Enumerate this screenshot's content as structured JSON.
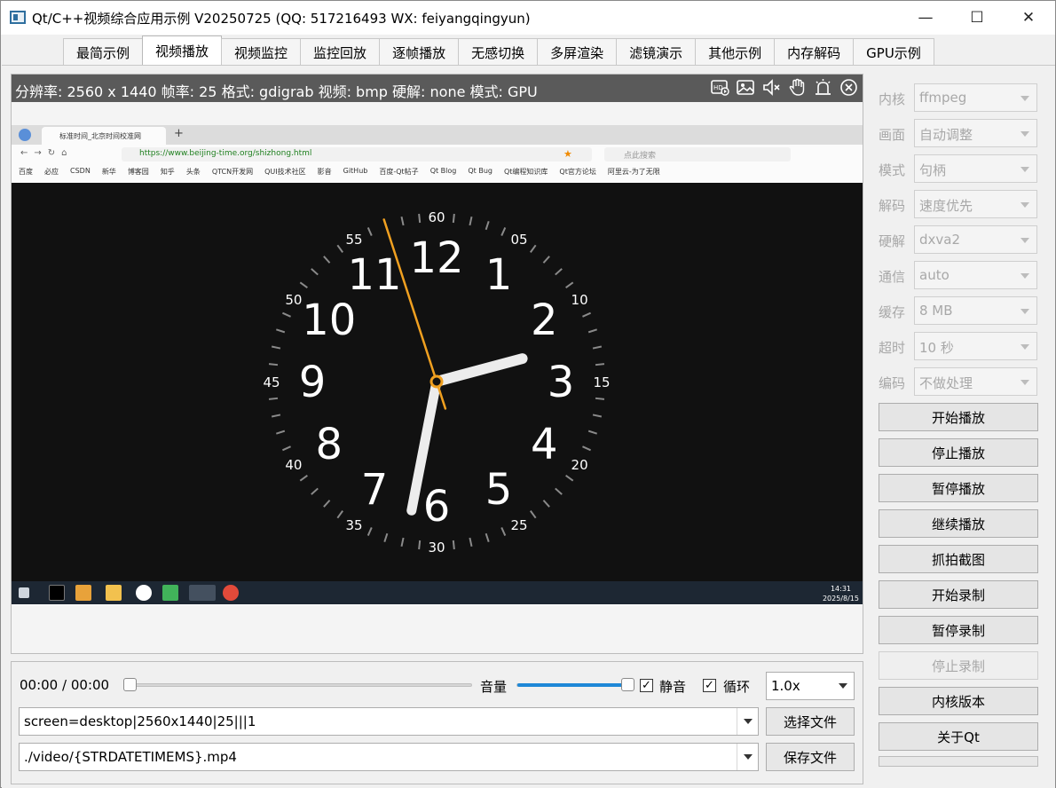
{
  "window": {
    "title": "Qt/C++视频综合应用示例 V20250725 (QQ: 517216493 WX: feiyangqingyun)",
    "minimize": "—",
    "maximize": "☐",
    "close": "✕"
  },
  "tabs": [
    {
      "label": "最简示例"
    },
    {
      "label": "视频播放"
    },
    {
      "label": "视频监控"
    },
    {
      "label": "监控回放"
    },
    {
      "label": "逐帧播放"
    },
    {
      "label": "无感切换"
    },
    {
      "label": "多屏渲染"
    },
    {
      "label": "滤镜演示"
    },
    {
      "label": "其他示例"
    },
    {
      "label": "内存解码"
    },
    {
      "label": "GPU示例"
    }
  ],
  "active_tab": "视频播放",
  "video": {
    "info": "分辨率: 2560 x 1440  帧率: 25  格式: gdigrab  视频: bmp  硬解: none  模式: GPU",
    "icons": [
      "record-icon",
      "image-icon",
      "mute-icon",
      "hand-icon",
      "alarm-icon",
      "close-icon"
    ]
  },
  "screen_content": {
    "browser_tab": "标准时间_北京时间校准网",
    "url": "https://www.beijing-time.org/shizhong.html",
    "search_placeholder": "点此搜索",
    "bookmarks": [
      "百度",
      "必应",
      "CSDN",
      "新华",
      "博客园",
      "知乎",
      "头条",
      "QTCN开发网",
      "QUI技术社区",
      "影音",
      "GitHub",
      "百度-Qt帖子",
      "Qt Blog",
      "Qt Bug",
      "Qt编程知识库",
      "Qt官方论坛",
      "阿里云-为了无限"
    ],
    "taskbar_time": "14:31",
    "taskbar_date": "2025/8/15",
    "clock_hours": [
      "12",
      "1",
      "2",
      "3",
      "4",
      "5",
      "6",
      "7",
      "8",
      "9",
      "10",
      "11"
    ],
    "clock_minutes": [
      "60",
      "05",
      "10",
      "15",
      "20",
      "25",
      "30",
      "35",
      "40",
      "45",
      "50",
      "55"
    ]
  },
  "playback": {
    "position": "00:00",
    "separator": "/",
    "duration": "00:00",
    "progress_fraction": 0.0,
    "volume_label": "音量",
    "volume_fraction": 0.98,
    "mute_label": "静音",
    "mute_checked": true,
    "loop_label": "循环",
    "loop_checked": true,
    "speed": "1.0x",
    "url_value": "screen=desktop|2560x1440|25|||1",
    "save_value": "./video/{STRDATETIMEMS}.mp4",
    "select_file": "选择文件",
    "save_file": "保存文件",
    "check_mark": "✓"
  },
  "side": {
    "options": [
      {
        "label": "内核",
        "value": "ffmpeg"
      },
      {
        "label": "画面",
        "value": "自动调整"
      },
      {
        "label": "模式",
        "value": "句柄"
      },
      {
        "label": "解码",
        "value": "速度优先"
      },
      {
        "label": "硬解",
        "value": "dxva2"
      },
      {
        "label": "通信",
        "value": "auto"
      },
      {
        "label": "缓存",
        "value": "8 MB"
      },
      {
        "label": "超时",
        "value": "10 秒"
      },
      {
        "label": "编码",
        "value": "不做处理"
      }
    ],
    "buttons": [
      {
        "label": "开始播放",
        "enabled": true
      },
      {
        "label": "停止播放",
        "enabled": true
      },
      {
        "label": "暂停播放",
        "enabled": true
      },
      {
        "label": "继续播放",
        "enabled": true
      },
      {
        "label": "抓拍截图",
        "enabled": true
      },
      {
        "label": "开始录制",
        "enabled": true
      },
      {
        "label": "暂停录制",
        "enabled": true
      },
      {
        "label": "停止录制",
        "enabled": false
      },
      {
        "label": "内核版本",
        "enabled": true
      },
      {
        "label": "关于Qt",
        "enabled": true
      }
    ]
  },
  "colors": {
    "accent": "#1e88d7",
    "clock_second_hand": "#f0a020",
    "clock_face": "#111111",
    "info_bar": "#5a5a5a"
  }
}
